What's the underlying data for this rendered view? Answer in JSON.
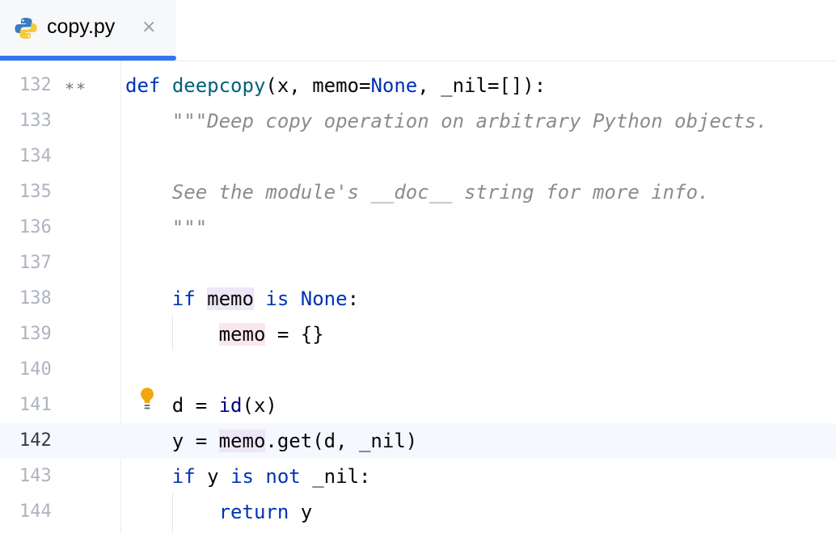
{
  "tab": {
    "label": "copy.py",
    "icon": "python-icon",
    "close": "×",
    "accent": "#3574f0"
  },
  "editor": {
    "current_line": "142",
    "stars": "∗∗",
    "lines": [
      {
        "num": "132",
        "def": "def",
        "name": "deepcopy",
        "p1": "(x, memo=",
        "none": "None",
        "p2": ", _nil=[]):"
      },
      {
        "num": "133",
        "text": "    \"\"\"Deep copy operation on arbitrary Python objects."
      },
      {
        "num": "134"
      },
      {
        "num": "135",
        "text": "    See the module's __doc__ string for more info."
      },
      {
        "num": "136",
        "text": "    \"\"\""
      },
      {
        "num": "137"
      },
      {
        "num": "138",
        "kw1": "if",
        "var": "memo",
        "kw2": "is",
        "none": "None",
        "colon": ":"
      },
      {
        "num": "139",
        "var": "memo",
        "rest": " = {}"
      },
      {
        "num": "140"
      },
      {
        "num": "141",
        "p1": "d = ",
        "id": "id",
        "p2": "(x)"
      },
      {
        "num": "142",
        "p1": "y = ",
        "var": "memo",
        "p2": ".get(d, _nil)"
      },
      {
        "num": "143",
        "kw1": "if",
        "mid": " y ",
        "kw2": "is not",
        "rest": " _nil:"
      },
      {
        "num": "144",
        "kw": "return",
        "rest": " y"
      }
    ]
  },
  "colors": {
    "keyword": "#0033b3",
    "function": "#00627a",
    "builtin": "#000080",
    "docstring": "#8c8c8c",
    "read_highlight": "#ece6f7",
    "write_highlight": "#f9e6ef",
    "bulb": "#f2a60d"
  }
}
